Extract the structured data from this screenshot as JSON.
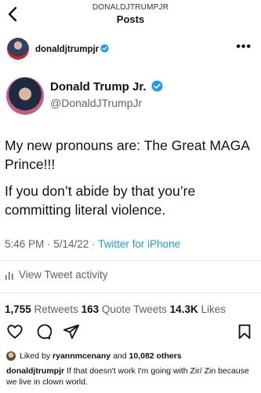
{
  "header": {
    "username_small": "DONALDJTRUMPJR",
    "title": "Posts"
  },
  "post": {
    "username": "donaldjtrumpjr",
    "more_icon": "more-dots-icon"
  },
  "tweet": {
    "display_name": "Donald Trump Jr.",
    "handle": "@DonaldJTrumpJr",
    "text_line1": "My new pronouns are: The Great MAGA Prince!!!",
    "text_line2": "If you don’t abide by that you’re committing literal violence.",
    "time": "5:46 PM · 5/14/22 · ",
    "source": "Twitter for iPhone",
    "activity_label": "View Tweet activity",
    "stats": {
      "retweets_count": "1,755",
      "retweets_label": " Retweets ",
      "quotes_count": "163",
      "quotes_label": " Quote Tweets ",
      "likes_count": "14.3K",
      "likes_label": " Likes"
    }
  },
  "likes": {
    "prefix": "Liked by ",
    "user": "ryannmcenany",
    "middle": " and ",
    "others": "10,082 others"
  },
  "caption": {
    "username": "donaldjtrumpjr",
    "text": " If that doesn't work I'm going with Zir/ Zin because we live in clown world."
  },
  "colors": {
    "verified": "#1d9bf0",
    "link": "#1d9bf0",
    "muted": "#566573"
  }
}
